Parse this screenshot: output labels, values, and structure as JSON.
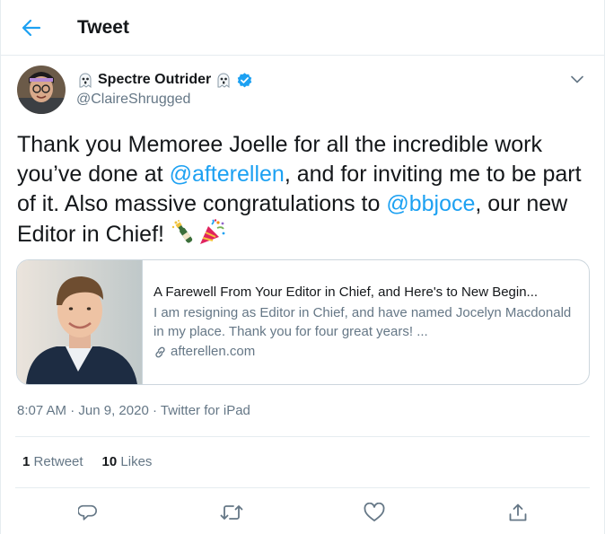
{
  "header": {
    "title": "Tweet",
    "back_icon": "arrow-left-icon"
  },
  "author": {
    "display_name": "Spectre Outrider",
    "handle": "@ClaireShrugged",
    "verified_icon": "verified-badge-icon",
    "name_emoji": "ghost"
  },
  "tweet": {
    "seg1": "Thank you Memoree Joelle for all the incredible work you’ve done at ",
    "mention1": "@afterellen",
    "seg2": ", and for inviting me to be part of it. Also massive congratulations to ",
    "mention2": "@bbjoce",
    "seg3": ", our new Editor in Chief! ",
    "emojis": [
      "bottle-with-popping-cork",
      "party-popper"
    ]
  },
  "card": {
    "title": "A Farewell From Your Editor in Chief, and Here's to New Begin...",
    "description": "I am resigning as Editor in Chief, and have named Jocelyn Macdonald in my place. Thank you for four great years! ...",
    "domain": "afterellen.com"
  },
  "meta": {
    "time": "8:07 AM",
    "sep1": " · ",
    "date": "Jun 9, 2020",
    "sep2": " · ",
    "source": "Twitter for iPad"
  },
  "stats": {
    "retweets_count": "1",
    "retweets_label": "Retweet",
    "likes_count": "10",
    "likes_label": "Likes"
  },
  "actions": [
    "reply-icon",
    "retweet-icon",
    "like-icon",
    "share-icon"
  ],
  "colors": {
    "accent": "#1da1f2",
    "text": "#14171a",
    "secondary": "#657786",
    "border": "#e6ecf0"
  }
}
